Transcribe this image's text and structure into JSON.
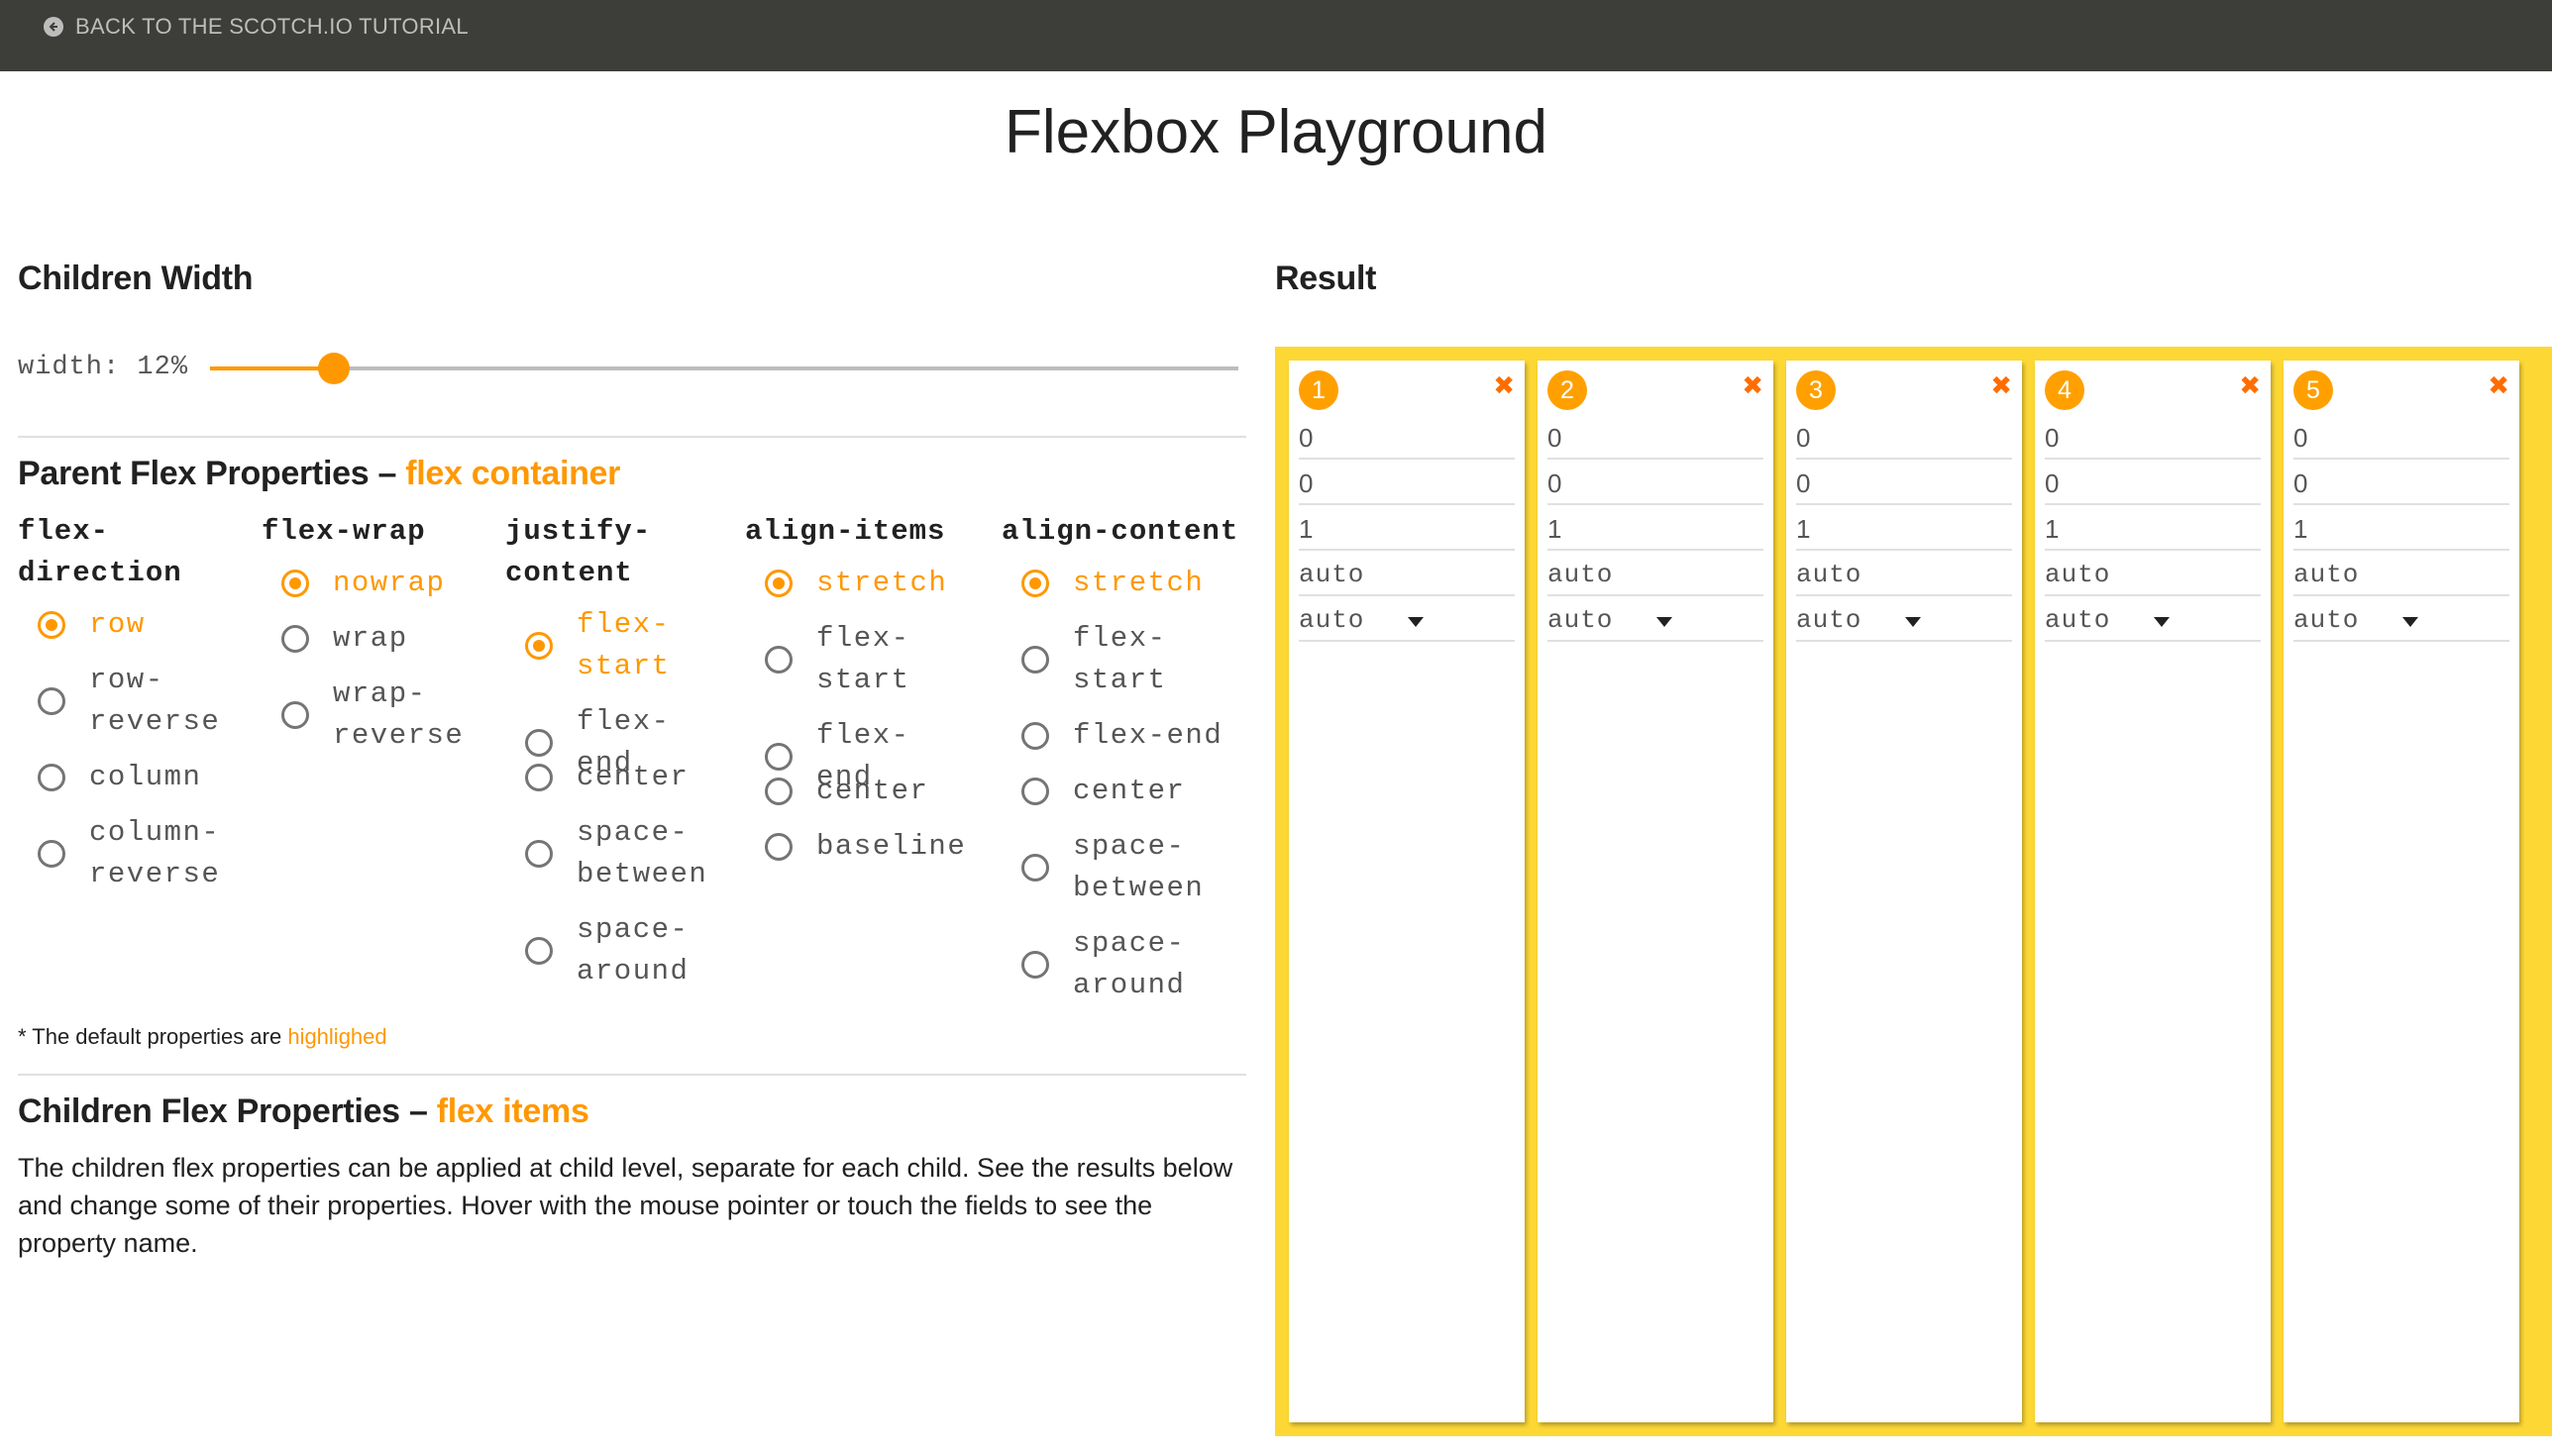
{
  "topbar": {
    "back_label": "BACK TO THE SCOTCH.IO TUTORIAL",
    "back_icon": "arrow-left-circle-icon"
  },
  "page_title": "Flexbox Playground",
  "children_width": {
    "heading": "Children Width",
    "label": "width: 12%",
    "value_percent": 12
  },
  "parent": {
    "heading": "Parent Flex Properties –",
    "heading_accent": "flex container",
    "columns": [
      {
        "name": [
          "flex-",
          "direction"
        ],
        "options": [
          {
            "label": [
              "row"
            ],
            "selected": true
          },
          {
            "label": [
              "row-",
              "reverse"
            ],
            "selected": false
          },
          {
            "label": [
              "column"
            ],
            "selected": false
          },
          {
            "label": [
              "column-",
              "reverse"
            ],
            "selected": false
          }
        ]
      },
      {
        "name": [
          "flex-wrap"
        ],
        "options": [
          {
            "label": [
              "nowrap"
            ],
            "selected": true
          },
          {
            "label": [
              "wrap"
            ],
            "selected": false
          },
          {
            "label": [
              "wrap-",
              "reverse"
            ],
            "selected": false
          }
        ]
      },
      {
        "name": [
          "justify-",
          "content"
        ],
        "options": [
          {
            "label": [
              "flex-",
              "start"
            ],
            "selected": true
          },
          {
            "label": [
              "flex-end"
            ],
            "selected": false
          },
          {
            "label": [
              "center"
            ],
            "selected": false
          },
          {
            "label": [
              "space-",
              "between"
            ],
            "selected": false
          },
          {
            "label": [
              "space-",
              "around"
            ],
            "selected": false
          }
        ]
      },
      {
        "name": [
          "align-items"
        ],
        "options": [
          {
            "label": [
              "stretch"
            ],
            "selected": true
          },
          {
            "label": [
              "flex-",
              "start"
            ],
            "selected": false
          },
          {
            "label": [
              "flex-end"
            ],
            "selected": false
          },
          {
            "label": [
              "center"
            ],
            "selected": false
          },
          {
            "label": [
              "baseline"
            ],
            "selected": false
          }
        ]
      },
      {
        "name": [
          "align-content"
        ],
        "options": [
          {
            "label": [
              "stretch"
            ],
            "selected": true
          },
          {
            "label": [
              "flex-",
              "start"
            ],
            "selected": false
          },
          {
            "label": [
              "flex-end"
            ],
            "selected": false
          },
          {
            "label": [
              "center"
            ],
            "selected": false
          },
          {
            "label": [
              "space-",
              "between"
            ],
            "selected": false
          },
          {
            "label": [
              "space-",
              "around"
            ],
            "selected": false
          }
        ]
      }
    ],
    "note_prefix": "* The default properties are",
    "note_accent": "highlighed"
  },
  "children": {
    "heading": "Children Flex Properties –",
    "heading_accent": "flex items",
    "description": "The children flex properties can be applied at child level, separate for each child. See the results below and change some of their properties. Hover with the mouse pointer or touch the fields to see the property name."
  },
  "result": {
    "heading": "Result",
    "close_icon": "close-x-icon",
    "items": [
      {
        "number": "1",
        "order": "0",
        "flex_shrink_0": "0",
        "flex_grow": "1",
        "flex_basis": "auto",
        "align_self": "auto"
      },
      {
        "number": "2",
        "order": "0",
        "flex_shrink_0": "0",
        "flex_grow": "1",
        "flex_basis": "auto",
        "align_self": "auto"
      },
      {
        "number": "3",
        "order": "0",
        "flex_shrink_0": "0",
        "flex_grow": "1",
        "flex_basis": "auto",
        "align_self": "auto"
      },
      {
        "number": "4",
        "order": "0",
        "flex_shrink_0": "0",
        "flex_grow": "1",
        "flex_basis": "auto",
        "align_self": "auto"
      },
      {
        "number": "5",
        "order": "0",
        "flex_shrink_0": "0",
        "flex_grow": "1",
        "flex_basis": "auto",
        "align_self": "auto"
      }
    ]
  },
  "colors": {
    "accent": "#ff9800",
    "topbar": "#3d3e3a",
    "result_bg": "#fdd835"
  }
}
